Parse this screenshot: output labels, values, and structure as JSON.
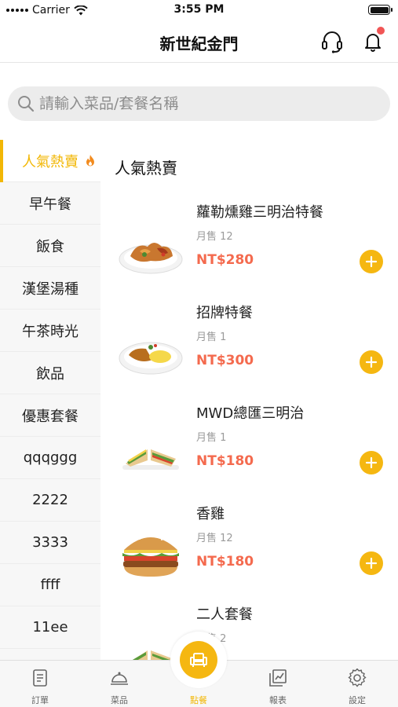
{
  "status_bar": {
    "carrier": "Carrier",
    "time": "3:55 PM"
  },
  "nav": {
    "title": "新世紀金門"
  },
  "search": {
    "placeholder": "請輸入菜品/套餐名稱"
  },
  "categories": [
    {
      "label": "人氣熱賣",
      "active": true
    },
    {
      "label": "早午餐"
    },
    {
      "label": "飯食"
    },
    {
      "label": "漢堡湯種"
    },
    {
      "label": "午茶時光"
    },
    {
      "label": "飲品"
    },
    {
      "label": "優惠套餐"
    },
    {
      "label": "qqqggg"
    },
    {
      "label": "2222"
    },
    {
      "label": "3333"
    },
    {
      "label": "ffff"
    },
    {
      "label": "11ee"
    }
  ],
  "section": {
    "title": "人氣熱賣"
  },
  "items": [
    {
      "name": "蘿勒燻雞三明治特餐",
      "sales": "月售 12",
      "price": "NT$280",
      "image": "chicken-plate"
    },
    {
      "name": "招牌特餐",
      "sales": "月售 1",
      "price": "NT$300",
      "image": "curry-plate"
    },
    {
      "name": "MWD總匯三明治",
      "sales": "月售 1",
      "price": "NT$180",
      "image": "sandwich"
    },
    {
      "name": "香雞",
      "sales": "月售 12",
      "price": "NT$180",
      "image": "burger"
    },
    {
      "name": "二人套餐",
      "sales": "月售 2",
      "price": "",
      "image": "sandwich"
    }
  ],
  "tabs": [
    {
      "label": "訂單",
      "icon": "document-icon"
    },
    {
      "label": "菜品",
      "icon": "cloche-icon"
    },
    {
      "label": "點餐",
      "icon": "armchair-icon",
      "active": true
    },
    {
      "label": "報表",
      "icon": "chart-icon"
    },
    {
      "label": "設定",
      "icon": "gear-icon"
    }
  ],
  "colors": {
    "accent": "#f5b711",
    "price": "#f46a4e",
    "badge": "#f15555"
  }
}
